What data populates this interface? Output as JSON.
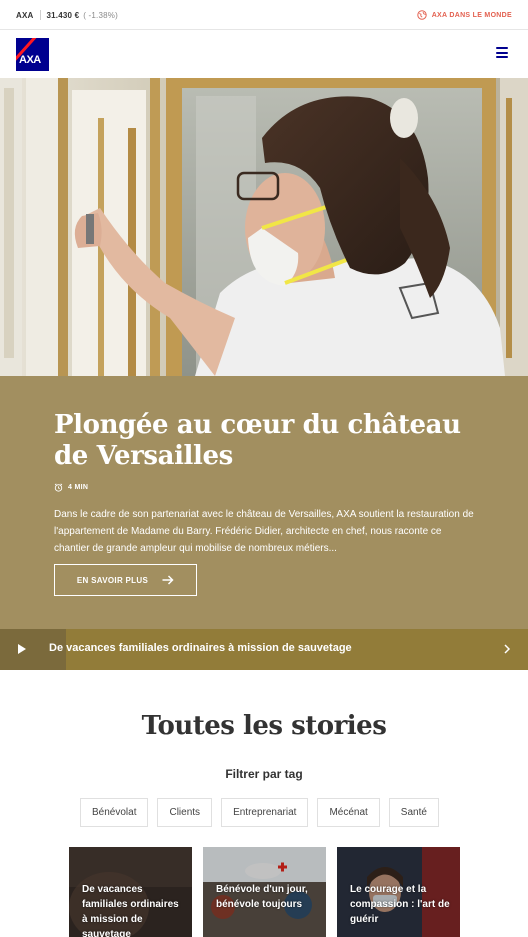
{
  "topbar": {
    "ticker_symbol": "AXA",
    "ticker_price": "31.430 €",
    "ticker_change": "( -1.38%)",
    "world_link": "AXA DANS LE MONDE",
    "world_icon": "globe-icon"
  },
  "header": {
    "logo_text": "AXA",
    "menu_icon": "hamburger-menu-icon"
  },
  "colors": {
    "brand_blue": "#00008f",
    "brand_red": "#ff1721",
    "hero_panel": "#a28f60",
    "story_bar": "#927c39",
    "accent_link": "#e36150"
  },
  "hero": {
    "title": "Plongée au cœur du château de Versailles",
    "read_time": "4 MIN",
    "read_time_icon": "clock-icon",
    "description": "Dans le cadre de son partenariat avec le château de Versailles, AXA soutient la restauration de l'appartement de Madame du Barry. Frédéric Didier, architecte en chef, nous raconte ce chantier de grande ampleur qui mobilise de nombreux métiers...",
    "cta_label": "EN SAVOIR PLUS",
    "cta_icon": "arrow-right-icon"
  },
  "story_bar": {
    "title": "De vacances familiales ordinaires à mission de sauvetage",
    "play_icon": "play-icon",
    "next_icon": "chevron-right-icon",
    "progress": 0.125
  },
  "stories": {
    "title": "Toutes les stories",
    "filter_label": "Filtrer par tag",
    "tags": [
      "Bénévolat",
      "Clients",
      "Entreprenariat",
      "Mécénat",
      "Santé"
    ],
    "cards": [
      {
        "title": "De vacances familiales ordinaires à mission de sauvetage"
      },
      {
        "title": "Bénévole d'un jour, bénévole toujours"
      },
      {
        "title": "Le courage et la compassion : l'art de guérir"
      }
    ]
  }
}
